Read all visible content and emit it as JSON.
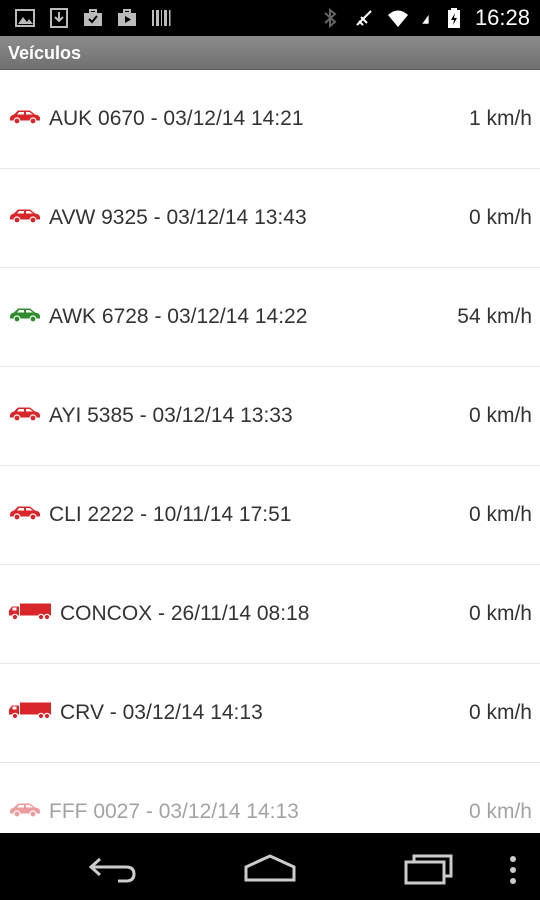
{
  "status_bar": {
    "time": "16:28",
    "left_icons": [
      "image-icon",
      "download-icon",
      "briefcase-check-icon",
      "play-store-icon",
      "barcode-icon"
    ],
    "right_icons": [
      "bluetooth-icon",
      "no-signal-icon",
      "wifi-icon",
      "battery-charging-icon"
    ]
  },
  "header": {
    "title": "Veículos"
  },
  "colors": {
    "stopped": "#d9262b",
    "moving": "#2e8b2e",
    "title_bar": "#7d7d7d"
  },
  "vehicles": [
    {
      "label": "AUK 0670 - 03/12/14 14:21",
      "speed": "1 km/h",
      "type": "car",
      "status": "stopped"
    },
    {
      "label": "AVW 9325 - 03/12/14 13:43",
      "speed": "0 km/h",
      "type": "car",
      "status": "stopped"
    },
    {
      "label": "AWK 6728 - 03/12/14 14:22",
      "speed": "54 km/h",
      "type": "car",
      "status": "moving"
    },
    {
      "label": "AYI 5385 - 03/12/14 13:33",
      "speed": "0 km/h",
      "type": "car",
      "status": "stopped"
    },
    {
      "label": "CLI 2222 - 10/11/14 17:51",
      "speed": "0 km/h",
      "type": "car",
      "status": "stopped"
    },
    {
      "label": "CONCOX - 26/11/14 08:18",
      "speed": "0 km/h",
      "type": "truck",
      "status": "stopped"
    },
    {
      "label": "CRV - 03/12/14 14:13",
      "speed": "0 km/h",
      "type": "truck",
      "status": "stopped"
    },
    {
      "label": "FFF 0027 - 03/12/14 14:13",
      "speed": "0 km/h",
      "type": "car",
      "status": "stopped"
    }
  ],
  "nav": [
    "back-icon",
    "home-icon",
    "recents-icon",
    "overflow-menu-icon"
  ]
}
